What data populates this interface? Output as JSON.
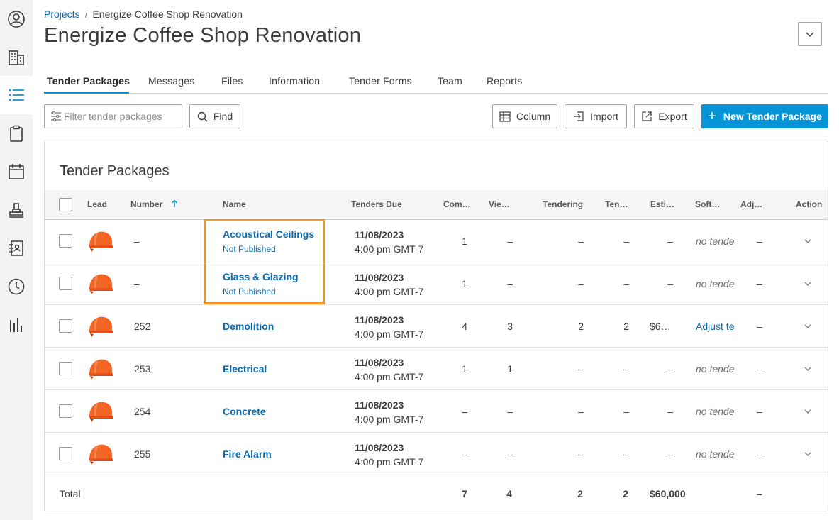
{
  "breadcrumb": {
    "link": "Projects",
    "separator": "/",
    "current": "Energize Coffee Shop Renovation"
  },
  "page_title": "Energize Coffee Shop Renovation",
  "tabs": [
    {
      "label": "Tender Packages"
    },
    {
      "label": "Messages"
    },
    {
      "label": "Files"
    },
    {
      "label": "Information"
    },
    {
      "label": "Tender Forms"
    },
    {
      "label": "Team"
    },
    {
      "label": "Reports"
    }
  ],
  "toolbar": {
    "filter_placeholder": "Filter tender packages",
    "find_label": "Find",
    "column_label": "Column",
    "import_label": "Import",
    "export_label": "Export",
    "new_label": "New Tender Package"
  },
  "card_title": "Tender Packages",
  "columns": {
    "lead": "Lead",
    "number": "Number",
    "name": "Name",
    "due": "Tenders Due",
    "com": "Com…",
    "vie": "Vie…",
    "tendering": "Tendering",
    "ten": "Ten…",
    "esti": "Esti…",
    "soft": "Soft…",
    "adj": "Adj…",
    "action": "Action"
  },
  "sort_icon": "arrow-up-icon",
  "rows": [
    {
      "number": "–",
      "name": "Acoustical Ceilings",
      "status": "Not Published",
      "due_date": "11/08/2023",
      "due_time": "4:00 pm GMT-7",
      "com": "1",
      "vie": "–",
      "tendering": "–",
      "ten": "–",
      "esti": "–",
      "soft": "no tenders",
      "adj": "–"
    },
    {
      "number": "–",
      "name": "Glass & Glazing",
      "status": "Not Published",
      "due_date": "11/08/2023",
      "due_time": "4:00 pm GMT-7",
      "com": "1",
      "vie": "–",
      "tendering": "–",
      "ten": "–",
      "esti": "–",
      "soft": "no tenders",
      "adj": "–"
    },
    {
      "number": "252",
      "name": "Demolition",
      "status": "",
      "due_date": "11/08/2023",
      "due_time": "4:00 pm GMT-7",
      "com": "4",
      "vie": "3",
      "tendering": "2",
      "ten": "2",
      "esti": "$6…",
      "soft": "Adjust tenders",
      "adj": "–"
    },
    {
      "number": "253",
      "name": "Electrical",
      "status": "",
      "due_date": "11/08/2023",
      "due_time": "4:00 pm GMT-7",
      "com": "1",
      "vie": "1",
      "tendering": "–",
      "ten": "–",
      "esti": "–",
      "soft": "no tenders",
      "adj": "–"
    },
    {
      "number": "254",
      "name": "Concrete",
      "status": "",
      "due_date": "11/08/2023",
      "due_time": "4:00 pm GMT-7",
      "com": "–",
      "vie": "–",
      "tendering": "–",
      "ten": "–",
      "esti": "–",
      "soft": "no tenders",
      "adj": "–"
    },
    {
      "number": "255",
      "name": "Fire Alarm",
      "status": "",
      "due_date": "11/08/2023",
      "due_time": "4:00 pm GMT-7",
      "com": "–",
      "vie": "–",
      "tendering": "–",
      "ten": "–",
      "esti": "–",
      "soft": "no tenders",
      "adj": "–"
    }
  ],
  "totals": {
    "label": "Total",
    "com": "7",
    "vie": "4",
    "tendering": "2",
    "ten": "2",
    "esti": "$60,000",
    "adj": "–"
  },
  "colors": {
    "accent": "#0696d7",
    "link": "#0a6ab0",
    "highlight": "#f7941d",
    "helmet": "#f26522"
  },
  "rail_icons": [
    "user-icon",
    "building-icon",
    "list-icon",
    "clipboard-icon",
    "calendar-icon",
    "stamp-icon",
    "address-book-icon",
    "clock-icon",
    "bar-chart-icon"
  ]
}
